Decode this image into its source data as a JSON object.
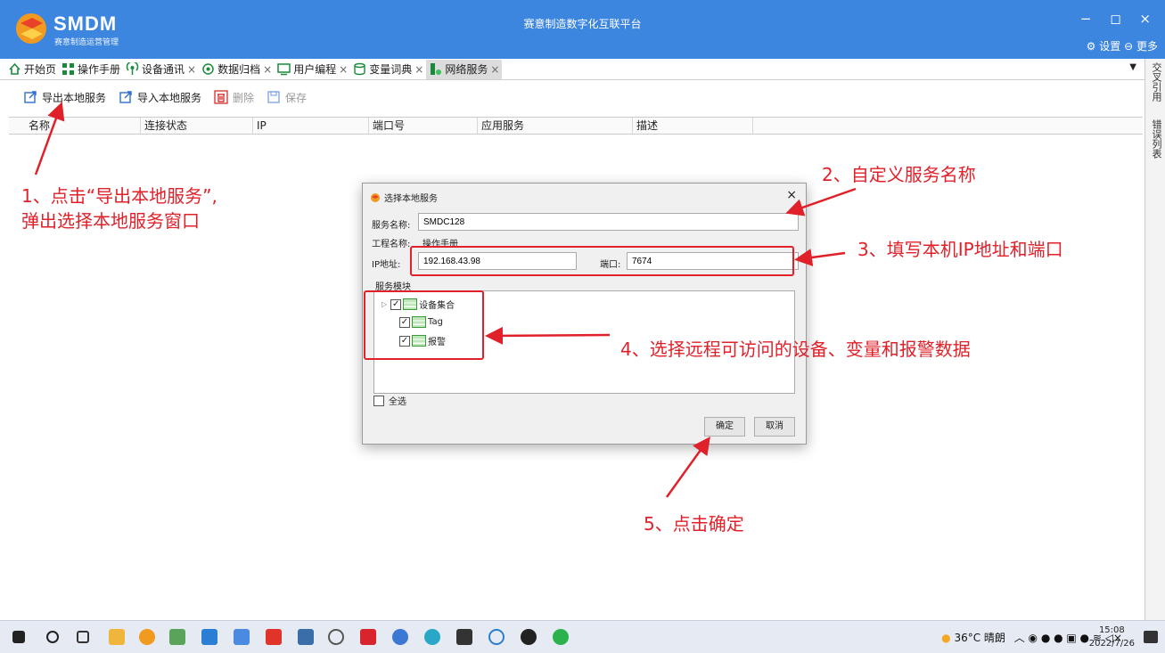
{
  "app": {
    "logo_text": "SMDM",
    "logo_sub": "赛意制造运营管理",
    "title": "赛意制造数字化互联平台",
    "window_controls": "− ◻ ×",
    "settings": "设置",
    "more": "更多"
  },
  "tabs": [
    {
      "label": "开始页",
      "icon": "home-icon",
      "closable": false
    },
    {
      "label": "操作手册",
      "icon": "grid-icon",
      "closable": false
    },
    {
      "label": "设备通讯",
      "icon": "signal-icon",
      "closable": true
    },
    {
      "label": "数据归档",
      "icon": "gear-icon",
      "closable": true
    },
    {
      "label": "用户编程",
      "icon": "monitor-icon",
      "closable": true
    },
    {
      "label": "变量词典",
      "icon": "database-icon",
      "closable": true
    },
    {
      "label": "网络服务",
      "icon": "server-icon",
      "closable": true,
      "active": true
    }
  ],
  "side_tabs": [
    "交叉引用",
    "错误列表"
  ],
  "toolbar": {
    "export_label": "导出本地服务",
    "import_label": "导入本地服务",
    "delete_label": "删除",
    "save_label": "保存"
  },
  "grid": {
    "columns": [
      "名称",
      "连接状态",
      "IP",
      "端口号",
      "应用服务",
      "描述"
    ]
  },
  "dialog": {
    "title": "选择本地服务",
    "service_name_label": "服务名称:",
    "service_name_value": "SMDC128",
    "project_name_label": "工程名称:",
    "project_name_value": "操作手册",
    "ip_label": "IP地址:",
    "ip_value": "192.168.43.98",
    "port_label": "端口:",
    "port_value": "7674",
    "modules_label": "服务模块",
    "modules": [
      {
        "label": "设备集合",
        "checked": true,
        "expandable": true
      },
      {
        "label": "Tag",
        "checked": true,
        "expandable": false
      },
      {
        "label": "报警",
        "checked": true,
        "expandable": false
      }
    ],
    "select_all_label": "全选",
    "ok_label": "确定",
    "cancel_label": "取消"
  },
  "annotations": {
    "step1_line1": "1、点击“导出本地服务”,",
    "step1_line2": "弹出选择本地服务窗口",
    "step2": "2、自定义服务名称",
    "step3": "3、填写本机IP地址和端口",
    "step4": "4、选择远程可访问的设备、变量和报警数据",
    "step5": "5、点击确定"
  },
  "taskbar": {
    "weather": "36°C 晴朗",
    "time": "15:08",
    "date": "2022/7/26"
  },
  "colors": {
    "titlebar": "#3d86e0",
    "annotation": "#e0212a"
  }
}
